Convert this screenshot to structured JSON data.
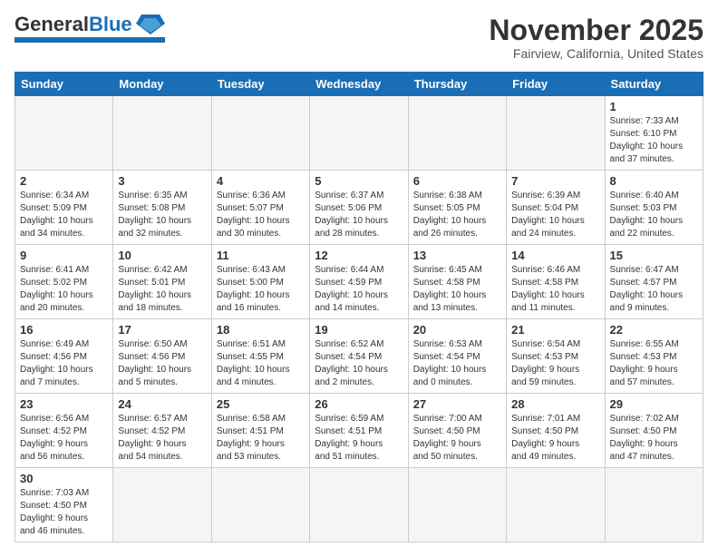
{
  "header": {
    "logo_general": "General",
    "logo_blue": "Blue",
    "title": "November 2025",
    "subtitle": "Fairview, California, United States"
  },
  "weekdays": [
    "Sunday",
    "Monday",
    "Tuesday",
    "Wednesday",
    "Thursday",
    "Friday",
    "Saturday"
  ],
  "weeks": [
    [
      {
        "day": "",
        "info": ""
      },
      {
        "day": "",
        "info": ""
      },
      {
        "day": "",
        "info": ""
      },
      {
        "day": "",
        "info": ""
      },
      {
        "day": "",
        "info": ""
      },
      {
        "day": "",
        "info": ""
      },
      {
        "day": "1",
        "info": "Sunrise: 7:33 AM\nSunset: 6:10 PM\nDaylight: 10 hours\nand 37 minutes."
      }
    ],
    [
      {
        "day": "2",
        "info": "Sunrise: 6:34 AM\nSunset: 5:09 PM\nDaylight: 10 hours\nand 34 minutes."
      },
      {
        "day": "3",
        "info": "Sunrise: 6:35 AM\nSunset: 5:08 PM\nDaylight: 10 hours\nand 32 minutes."
      },
      {
        "day": "4",
        "info": "Sunrise: 6:36 AM\nSunset: 5:07 PM\nDaylight: 10 hours\nand 30 minutes."
      },
      {
        "day": "5",
        "info": "Sunrise: 6:37 AM\nSunset: 5:06 PM\nDaylight: 10 hours\nand 28 minutes."
      },
      {
        "day": "6",
        "info": "Sunrise: 6:38 AM\nSunset: 5:05 PM\nDaylight: 10 hours\nand 26 minutes."
      },
      {
        "day": "7",
        "info": "Sunrise: 6:39 AM\nSunset: 5:04 PM\nDaylight: 10 hours\nand 24 minutes."
      },
      {
        "day": "8",
        "info": "Sunrise: 6:40 AM\nSunset: 5:03 PM\nDaylight: 10 hours\nand 22 minutes."
      }
    ],
    [
      {
        "day": "9",
        "info": "Sunrise: 6:41 AM\nSunset: 5:02 PM\nDaylight: 10 hours\nand 20 minutes."
      },
      {
        "day": "10",
        "info": "Sunrise: 6:42 AM\nSunset: 5:01 PM\nDaylight: 10 hours\nand 18 minutes."
      },
      {
        "day": "11",
        "info": "Sunrise: 6:43 AM\nSunset: 5:00 PM\nDaylight: 10 hours\nand 16 minutes."
      },
      {
        "day": "12",
        "info": "Sunrise: 6:44 AM\nSunset: 4:59 PM\nDaylight: 10 hours\nand 14 minutes."
      },
      {
        "day": "13",
        "info": "Sunrise: 6:45 AM\nSunset: 4:58 PM\nDaylight: 10 hours\nand 13 minutes."
      },
      {
        "day": "14",
        "info": "Sunrise: 6:46 AM\nSunset: 4:58 PM\nDaylight: 10 hours\nand 11 minutes."
      },
      {
        "day": "15",
        "info": "Sunrise: 6:47 AM\nSunset: 4:57 PM\nDaylight: 10 hours\nand 9 minutes."
      }
    ],
    [
      {
        "day": "16",
        "info": "Sunrise: 6:49 AM\nSunset: 4:56 PM\nDaylight: 10 hours\nand 7 minutes."
      },
      {
        "day": "17",
        "info": "Sunrise: 6:50 AM\nSunset: 4:56 PM\nDaylight: 10 hours\nand 5 minutes."
      },
      {
        "day": "18",
        "info": "Sunrise: 6:51 AM\nSunset: 4:55 PM\nDaylight: 10 hours\nand 4 minutes."
      },
      {
        "day": "19",
        "info": "Sunrise: 6:52 AM\nSunset: 4:54 PM\nDaylight: 10 hours\nand 2 minutes."
      },
      {
        "day": "20",
        "info": "Sunrise: 6:53 AM\nSunset: 4:54 PM\nDaylight: 10 hours\nand 0 minutes."
      },
      {
        "day": "21",
        "info": "Sunrise: 6:54 AM\nSunset: 4:53 PM\nDaylight: 9 hours\nand 59 minutes."
      },
      {
        "day": "22",
        "info": "Sunrise: 6:55 AM\nSunset: 4:53 PM\nDaylight: 9 hours\nand 57 minutes."
      }
    ],
    [
      {
        "day": "23",
        "info": "Sunrise: 6:56 AM\nSunset: 4:52 PM\nDaylight: 9 hours\nand 56 minutes."
      },
      {
        "day": "24",
        "info": "Sunrise: 6:57 AM\nSunset: 4:52 PM\nDaylight: 9 hours\nand 54 minutes."
      },
      {
        "day": "25",
        "info": "Sunrise: 6:58 AM\nSunset: 4:51 PM\nDaylight: 9 hours\nand 53 minutes."
      },
      {
        "day": "26",
        "info": "Sunrise: 6:59 AM\nSunset: 4:51 PM\nDaylight: 9 hours\nand 51 minutes."
      },
      {
        "day": "27",
        "info": "Sunrise: 7:00 AM\nSunset: 4:50 PM\nDaylight: 9 hours\nand 50 minutes."
      },
      {
        "day": "28",
        "info": "Sunrise: 7:01 AM\nSunset: 4:50 PM\nDaylight: 9 hours\nand 49 minutes."
      },
      {
        "day": "29",
        "info": "Sunrise: 7:02 AM\nSunset: 4:50 PM\nDaylight: 9 hours\nand 47 minutes."
      }
    ],
    [
      {
        "day": "30",
        "info": "Sunrise: 7:03 AM\nSunset: 4:50 PM\nDaylight: 9 hours\nand 46 minutes."
      },
      {
        "day": "",
        "info": ""
      },
      {
        "day": "",
        "info": ""
      },
      {
        "day": "",
        "info": ""
      },
      {
        "day": "",
        "info": ""
      },
      {
        "day": "",
        "info": ""
      },
      {
        "day": "",
        "info": ""
      }
    ]
  ]
}
